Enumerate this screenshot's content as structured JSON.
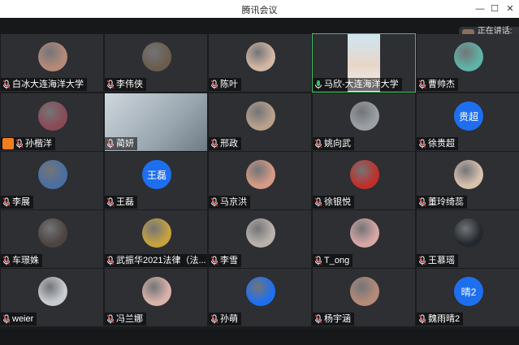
{
  "window": {
    "title": "腾讯会议",
    "controls": [
      "—",
      "☐",
      "✕"
    ]
  },
  "speaking": {
    "label": "正在讲话: 马"
  },
  "colors": {
    "accent_blue": "#1e6ff0",
    "active_border": "#3fbf5d",
    "tile_bg": "#2d2f33"
  },
  "participants": [
    {
      "name": "白冰大连海洋大学",
      "avatar": "photo"
    },
    {
      "name": "李伟侠",
      "avatar": "photo"
    },
    {
      "name": "陈叶",
      "avatar": "photo"
    },
    {
      "name": "马欣-大连海洋大学",
      "avatar": "video",
      "speaking": true
    },
    {
      "name": "曹帅杰",
      "avatar": "photo"
    },
    {
      "name": "孙楷洋",
      "avatar": "photo",
      "host_badge": true
    },
    {
      "name": "蔺妍",
      "avatar": "video"
    },
    {
      "name": "邢政",
      "avatar": "photo"
    },
    {
      "name": "姚向武",
      "avatar": "photo"
    },
    {
      "name": "徐贵超",
      "avatar": "text",
      "avatar_text": "贵超"
    },
    {
      "name": "李展",
      "avatar": "photo"
    },
    {
      "name": "王磊",
      "avatar": "text",
      "avatar_text": "王磊"
    },
    {
      "name": "马京洪",
      "avatar": "photo"
    },
    {
      "name": "徐银悦",
      "avatar": "photo"
    },
    {
      "name": "董玲绮蕊",
      "avatar": "photo"
    },
    {
      "name": "车璟姝",
      "avatar": "photo"
    },
    {
      "name": "武振华2021法律（法...",
      "avatar": "photo"
    },
    {
      "name": "李雪",
      "avatar": "photo"
    },
    {
      "name": "T_ong",
      "avatar": "photo"
    },
    {
      "name": "王慕瑶",
      "avatar": "photo"
    },
    {
      "name": "weier",
      "avatar": "photo"
    },
    {
      "name": "冯兰娜",
      "avatar": "photo"
    },
    {
      "name": "孙萌",
      "avatar": "photo"
    },
    {
      "name": "杨宇涵",
      "avatar": "photo"
    },
    {
      "name": "魏雨晴2",
      "avatar": "text",
      "avatar_text": "晴2"
    }
  ]
}
